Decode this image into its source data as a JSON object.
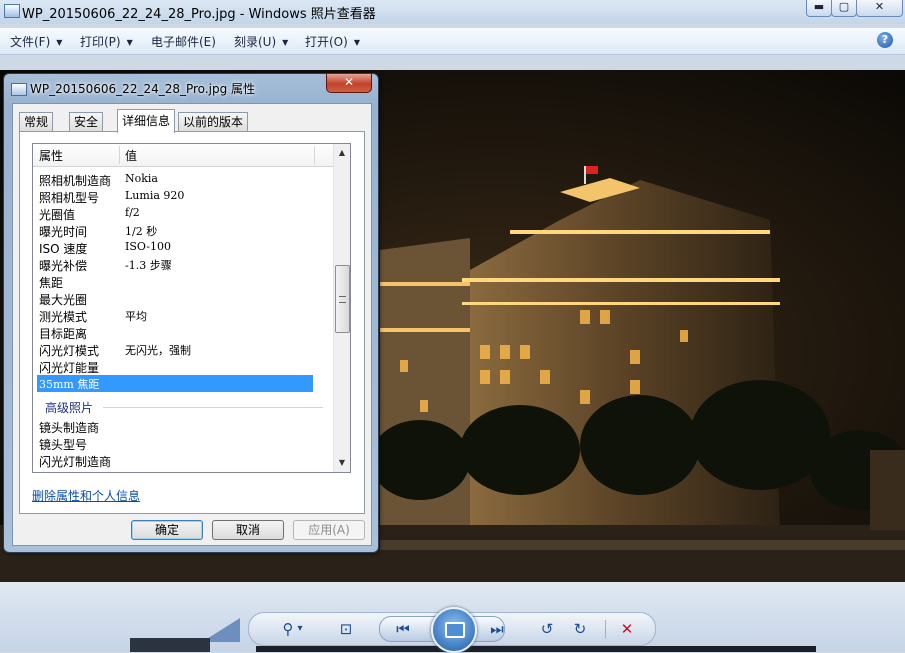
{
  "window": {
    "title": "WP_20150606_22_24_28_Pro.jpg - Windows 照片查看器",
    "min_glyph": "▬",
    "max_glyph": "▢",
    "close_glyph": "✕"
  },
  "menu": {
    "items": [
      {
        "label": "文件(F)"
      },
      {
        "label": "打印(P)"
      },
      {
        "label": "电子邮件(E)"
      },
      {
        "label": "刻录(U)"
      },
      {
        "label": "打开(O)"
      }
    ],
    "caret": "▼",
    "help_glyph": "?"
  },
  "dialog": {
    "title": "WP_20150606_22_24_28_Pro.jpg 属性",
    "close_glyph": "✕",
    "tabs": [
      "常规",
      "安全",
      "详细信息",
      "以前的版本"
    ],
    "active_tab": "详细信息",
    "columns": {
      "property": "属性",
      "value": "值"
    },
    "rows": [
      {
        "p": "照相机制造商",
        "v": "Nokia"
      },
      {
        "p": "照相机型号",
        "v": "Lumia 920"
      },
      {
        "p": "光圈值",
        "v": "f/2"
      },
      {
        "p": "曝光时间",
        "v": "1/2 秒"
      },
      {
        "p": "ISO 速度",
        "v": "ISO-100"
      },
      {
        "p": "曝光补偿",
        "v": "-1.3 步骤"
      },
      {
        "p": "焦距",
        "v": ""
      },
      {
        "p": "最大光圈",
        "v": ""
      },
      {
        "p": "测光模式",
        "v": "平均"
      },
      {
        "p": "目标距离",
        "v": ""
      },
      {
        "p": "闪光灯模式",
        "v": "无闪光，强制"
      },
      {
        "p": "闪光灯能量",
        "v": ""
      },
      {
        "p": "35mm 焦距",
        "v": ""
      }
    ],
    "group_label": "高级照片",
    "rows_advanced": [
      {
        "p": "镜头制造商",
        "v": ""
      },
      {
        "p": "镜头型号",
        "v": ""
      },
      {
        "p": "闪光灯制造商",
        "v": ""
      }
    ],
    "scroll_up": "▲",
    "scroll_down": "▼",
    "link": "删除属性和个人信息",
    "buttons": {
      "ok": "确定",
      "cancel": "取消",
      "apply": "应用(A)"
    }
  },
  "toolbar": {
    "zoom_glyph": "⚲",
    "zoom_caret": "▾",
    "fit_glyph": "⊡",
    "prev_glyph": "⏮",
    "next_glyph": "⏭",
    "rotate_ccw_glyph": "↺",
    "rotate_cw_glyph": "↻",
    "delete_glyph": "✕"
  },
  "colors": {
    "selection": "#3399ff",
    "link": "#0a4ea3",
    "delete": "#c8102e"
  }
}
